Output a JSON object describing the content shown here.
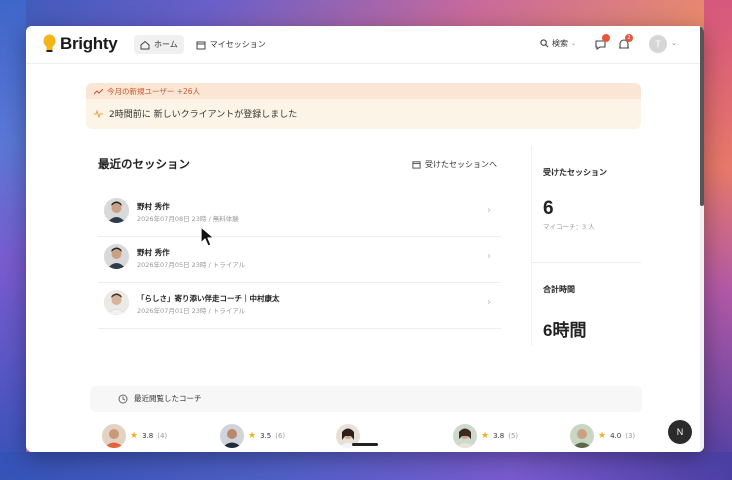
{
  "app": {
    "name": "Brighty"
  },
  "nav": {
    "home": "ホーム",
    "my_sessions": "マイセッション"
  },
  "header": {
    "search": "検索",
    "avatar_initial": "T",
    "notif_badge_2": "2"
  },
  "banner": {
    "new_users": "今月の新規ユーザー +26人",
    "event": "2時間前に 新しいクライアントが登録しました"
  },
  "sessions": {
    "title": "最近のセッション",
    "link_label": "受けたセッションへ",
    "items": [
      {
        "name": "野村 秀作",
        "meta": "2026年07月08日 23時 / 無料体験"
      },
      {
        "name": "野村 秀作",
        "meta": "2026年07月05日 23時 / トライアル"
      },
      {
        "name": "「らしさ」寄り添い伴走コーチ｜中村康太",
        "meta": "2026年07月01日 23時 / トライアル"
      }
    ]
  },
  "stats": {
    "received_label": "受けたセッション",
    "received_value": "6",
    "received_sub": "マイコーチ：3 人",
    "total_label": "合計時間",
    "total_value": "6時間"
  },
  "recent": {
    "title": "最近閲覧したコーチ",
    "coaches": [
      {
        "rating": "3.8",
        "count": "(4)"
      },
      {
        "rating": "3.5",
        "count": "(6)"
      },
      {
        "rating": "",
        "count": ""
      },
      {
        "rating": "3.8",
        "count": "(5)"
      },
      {
        "rating": "4.0",
        "count": "(3)"
      }
    ]
  },
  "fab": {
    "label": "N"
  },
  "colors": {
    "accent": "#c7582e",
    "banner_bg": "#fdf4e8",
    "badge": "#e4573d",
    "star": "#f2b01e"
  }
}
